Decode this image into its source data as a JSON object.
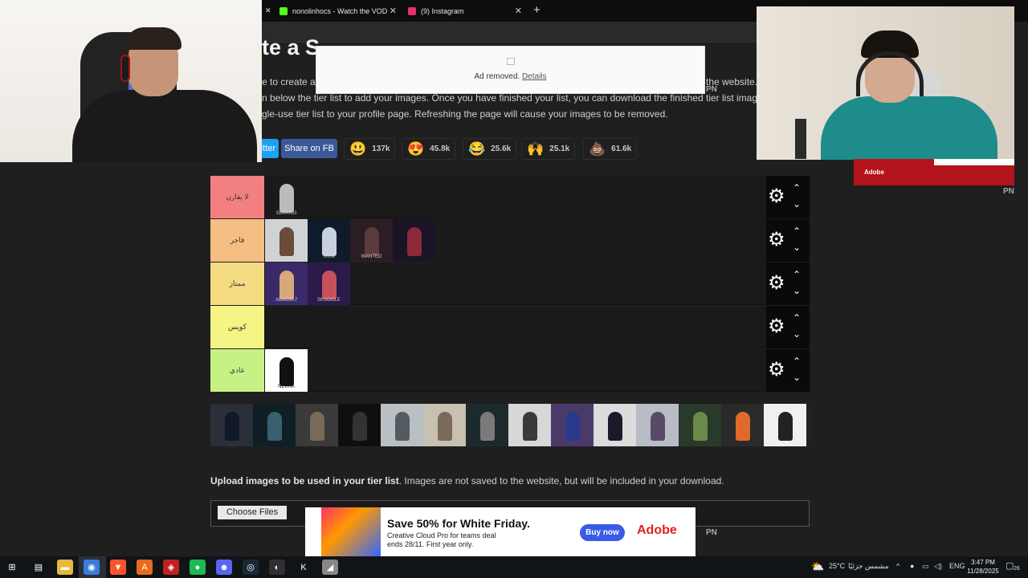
{
  "tabs": [
    {
      "title": "nonolinhocs - Watch the VOD",
      "close": "✕",
      "color": "#53fc18"
    },
    {
      "title": "(9) Instagram",
      "close": "✕",
      "color": "#e1306c"
    }
  ],
  "new_tab": "+",
  "partial_tab_close": "✕",
  "page": {
    "heading": "te a S",
    "para1_left": "e to create a",
    "para1_right": "the website.",
    "para2": "n below the tier list to add your images. Once you have finished your list, you can download the finished tier list image. It is",
    "para3": "gle-use tier list to your profile page. Refreshing the page will cause your images to be removed."
  },
  "ad_removed": {
    "text": "Ad removed.",
    "link": "Details"
  },
  "pn_marks": [
    "PN",
    "PN",
    "PN"
  ],
  "share": {
    "twitter": "itter",
    "facebook": "Share on FB"
  },
  "reactions": [
    {
      "emoji": "😃",
      "count": "137k"
    },
    {
      "emoji": "😍",
      "count": "45.8k"
    },
    {
      "emoji": "😂",
      "count": "25.6k"
    },
    {
      "emoji": "🙌",
      "count": "25.1k"
    },
    {
      "emoji": "💩",
      "count": "61.6k"
    }
  ],
  "tiers": [
    {
      "label": "لا يقارن",
      "color": "#f28080",
      "images": [
        {
          "tag": "SLAXX53",
          "bg": "#1a1a1a",
          "fig": "#bbbbbb"
        }
      ]
    },
    {
      "label": "فاجر",
      "color": "#f5be82",
      "images": [
        {
          "tag": "",
          "bg": "#cfd3d6",
          "fig": "#6b4b3a"
        },
        {
          "tag": "Snow",
          "bg": "#0f1a2a",
          "fig": "#c8d0e0"
        },
        {
          "tag": "WANTED",
          "bg": "#2a1e22",
          "fig": "#5a3a3a"
        },
        {
          "tag": "",
          "bg": "#1b1426",
          "fig": "#8c2a3a"
        }
      ]
    },
    {
      "label": "ممتاز",
      "color": "#f5dc82",
      "images": [
        {
          "tag": "ABDOJA7",
          "bg": "#3a2a6a",
          "fig": "#d8a878"
        },
        {
          "tag": "SKSOGLE",
          "bg": "#2a1a4a",
          "fig": "#c8505a"
        }
      ]
    },
    {
      "label": "كويس",
      "color": "#f5f585",
      "images": []
    },
    {
      "label": "عادي",
      "color": "#c6f285",
      "images": [
        {
          "tag": "NEKRA",
          "bg": "#ffffff",
          "fig": "#111111"
        }
      ]
    }
  ],
  "tier_controls": {
    "gear": "⚙",
    "up": "⌃",
    "down": "⌄"
  },
  "pool": [
    {
      "bg": "#2a2f3a",
      "fig": "#111826"
    },
    {
      "bg": "#0e1f25",
      "fig": "#3a6070"
    },
    {
      "bg": "#3a3a3a",
      "fig": "#7a6a5a"
    },
    {
      "bg": "#0f0f0f",
      "fig": "#333333"
    },
    {
      "bg": "#b9c0c4",
      "fig": "#555a60"
    },
    {
      "bg": "#c8c0b0",
      "fig": "#7a6a5a"
    },
    {
      "bg": "#1c2a2e",
      "fig": "#7a7a7a"
    },
    {
      "bg": "#d8d8d8",
      "fig": "#3a3a3a"
    },
    {
      "bg": "#4a3a6a",
      "fig": "#2a3a8a"
    },
    {
      "bg": "#dcdcdc",
      "fig": "#1a1a2a"
    },
    {
      "bg": "#b8bcc4",
      "fig": "#5a4a6a"
    },
    {
      "bg": "#2a3a2a",
      "fig": "#6a8a4a"
    },
    {
      "bg": "#2a2a2a",
      "fig": "#e06a2a"
    },
    {
      "bg": "#f0f0f0",
      "fig": "#222222"
    }
  ],
  "upload": {
    "bold": "Upload images to be used in your tier list",
    "rest": ". Images are not saved to the website, but will be included in your download.",
    "button": "Choose Files"
  },
  "bottom_ad": {
    "headline": "Save 50% for White Friday.",
    "sub": "Creative Cloud Pro for teams deal ends 28/11. First year only.",
    "cta": "Buy now",
    "brand": "Adobe"
  },
  "adobe_mini": {
    "label": "Adobe"
  },
  "taskbar": {
    "weather": "25°C",
    "weather_text": "مشمس جزئيًا",
    "lang": "ENG",
    "time": "3:47 PM",
    "date": "11/28/2025",
    "notif": "26"
  },
  "taskbar_apps": [
    {
      "name": "windows-icon",
      "glyph": "⊞",
      "color": "#111417"
    },
    {
      "name": "task-view-icon",
      "glyph": "▤",
      "color": "#111417"
    },
    {
      "name": "file-explorer-icon",
      "glyph": "▬",
      "color": "#e8b83a"
    },
    {
      "name": "chrome-icon",
      "glyph": "◉",
      "color": "#3a7be0"
    },
    {
      "name": "brave-icon",
      "glyph": "▼",
      "color": "#fb542b"
    },
    {
      "name": "app-a-icon",
      "glyph": "A",
      "color": "#e86a1a"
    },
    {
      "name": "gamepad-icon",
      "glyph": "◈",
      "color": "#c02020"
    },
    {
      "name": "spotify-icon",
      "glyph": "●",
      "color": "#1db954"
    },
    {
      "name": "discord-icon",
      "glyph": "☻",
      "color": "#5865f2"
    },
    {
      "name": "steam-icon",
      "glyph": "◎",
      "color": "#1b2838"
    },
    {
      "name": "obs-icon",
      "glyph": "◐",
      "color": "#302e31"
    },
    {
      "name": "app-k-icon",
      "glyph": "K",
      "color": "#111417"
    },
    {
      "name": "app-wing-icon",
      "glyph": "◢",
      "color": "#888888"
    }
  ]
}
